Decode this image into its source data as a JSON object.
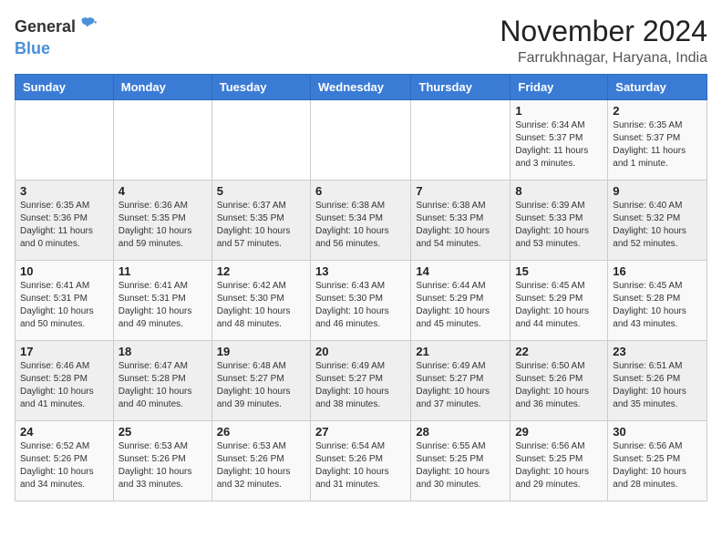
{
  "logo": {
    "general": "General",
    "blue": "Blue"
  },
  "title": "November 2024",
  "location": "Farrukhnagar, Haryana, India",
  "headers": [
    "Sunday",
    "Monday",
    "Tuesday",
    "Wednesday",
    "Thursday",
    "Friday",
    "Saturday"
  ],
  "weeks": [
    [
      {
        "day": "",
        "info": ""
      },
      {
        "day": "",
        "info": ""
      },
      {
        "day": "",
        "info": ""
      },
      {
        "day": "",
        "info": ""
      },
      {
        "day": "",
        "info": ""
      },
      {
        "day": "1",
        "info": "Sunrise: 6:34 AM\nSunset: 5:37 PM\nDaylight: 11 hours\nand 3 minutes."
      },
      {
        "day": "2",
        "info": "Sunrise: 6:35 AM\nSunset: 5:37 PM\nDaylight: 11 hours\nand 1 minute."
      }
    ],
    [
      {
        "day": "3",
        "info": "Sunrise: 6:35 AM\nSunset: 5:36 PM\nDaylight: 11 hours\nand 0 minutes."
      },
      {
        "day": "4",
        "info": "Sunrise: 6:36 AM\nSunset: 5:35 PM\nDaylight: 10 hours\nand 59 minutes."
      },
      {
        "day": "5",
        "info": "Sunrise: 6:37 AM\nSunset: 5:35 PM\nDaylight: 10 hours\nand 57 minutes."
      },
      {
        "day": "6",
        "info": "Sunrise: 6:38 AM\nSunset: 5:34 PM\nDaylight: 10 hours\nand 56 minutes."
      },
      {
        "day": "7",
        "info": "Sunrise: 6:38 AM\nSunset: 5:33 PM\nDaylight: 10 hours\nand 54 minutes."
      },
      {
        "day": "8",
        "info": "Sunrise: 6:39 AM\nSunset: 5:33 PM\nDaylight: 10 hours\nand 53 minutes."
      },
      {
        "day": "9",
        "info": "Sunrise: 6:40 AM\nSunset: 5:32 PM\nDaylight: 10 hours\nand 52 minutes."
      }
    ],
    [
      {
        "day": "10",
        "info": "Sunrise: 6:41 AM\nSunset: 5:31 PM\nDaylight: 10 hours\nand 50 minutes."
      },
      {
        "day": "11",
        "info": "Sunrise: 6:41 AM\nSunset: 5:31 PM\nDaylight: 10 hours\nand 49 minutes."
      },
      {
        "day": "12",
        "info": "Sunrise: 6:42 AM\nSunset: 5:30 PM\nDaylight: 10 hours\nand 48 minutes."
      },
      {
        "day": "13",
        "info": "Sunrise: 6:43 AM\nSunset: 5:30 PM\nDaylight: 10 hours\nand 46 minutes."
      },
      {
        "day": "14",
        "info": "Sunrise: 6:44 AM\nSunset: 5:29 PM\nDaylight: 10 hours\nand 45 minutes."
      },
      {
        "day": "15",
        "info": "Sunrise: 6:45 AM\nSunset: 5:29 PM\nDaylight: 10 hours\nand 44 minutes."
      },
      {
        "day": "16",
        "info": "Sunrise: 6:45 AM\nSunset: 5:28 PM\nDaylight: 10 hours\nand 43 minutes."
      }
    ],
    [
      {
        "day": "17",
        "info": "Sunrise: 6:46 AM\nSunset: 5:28 PM\nDaylight: 10 hours\nand 41 minutes."
      },
      {
        "day": "18",
        "info": "Sunrise: 6:47 AM\nSunset: 5:28 PM\nDaylight: 10 hours\nand 40 minutes."
      },
      {
        "day": "19",
        "info": "Sunrise: 6:48 AM\nSunset: 5:27 PM\nDaylight: 10 hours\nand 39 minutes."
      },
      {
        "day": "20",
        "info": "Sunrise: 6:49 AM\nSunset: 5:27 PM\nDaylight: 10 hours\nand 38 minutes."
      },
      {
        "day": "21",
        "info": "Sunrise: 6:49 AM\nSunset: 5:27 PM\nDaylight: 10 hours\nand 37 minutes."
      },
      {
        "day": "22",
        "info": "Sunrise: 6:50 AM\nSunset: 5:26 PM\nDaylight: 10 hours\nand 36 minutes."
      },
      {
        "day": "23",
        "info": "Sunrise: 6:51 AM\nSunset: 5:26 PM\nDaylight: 10 hours\nand 35 minutes."
      }
    ],
    [
      {
        "day": "24",
        "info": "Sunrise: 6:52 AM\nSunset: 5:26 PM\nDaylight: 10 hours\nand 34 minutes."
      },
      {
        "day": "25",
        "info": "Sunrise: 6:53 AM\nSunset: 5:26 PM\nDaylight: 10 hours\nand 33 minutes."
      },
      {
        "day": "26",
        "info": "Sunrise: 6:53 AM\nSunset: 5:26 PM\nDaylight: 10 hours\nand 32 minutes."
      },
      {
        "day": "27",
        "info": "Sunrise: 6:54 AM\nSunset: 5:26 PM\nDaylight: 10 hours\nand 31 minutes."
      },
      {
        "day": "28",
        "info": "Sunrise: 6:55 AM\nSunset: 5:25 PM\nDaylight: 10 hours\nand 30 minutes."
      },
      {
        "day": "29",
        "info": "Sunrise: 6:56 AM\nSunset: 5:25 PM\nDaylight: 10 hours\nand 29 minutes."
      },
      {
        "day": "30",
        "info": "Sunrise: 6:56 AM\nSunset: 5:25 PM\nDaylight: 10 hours\nand 28 minutes."
      }
    ]
  ]
}
